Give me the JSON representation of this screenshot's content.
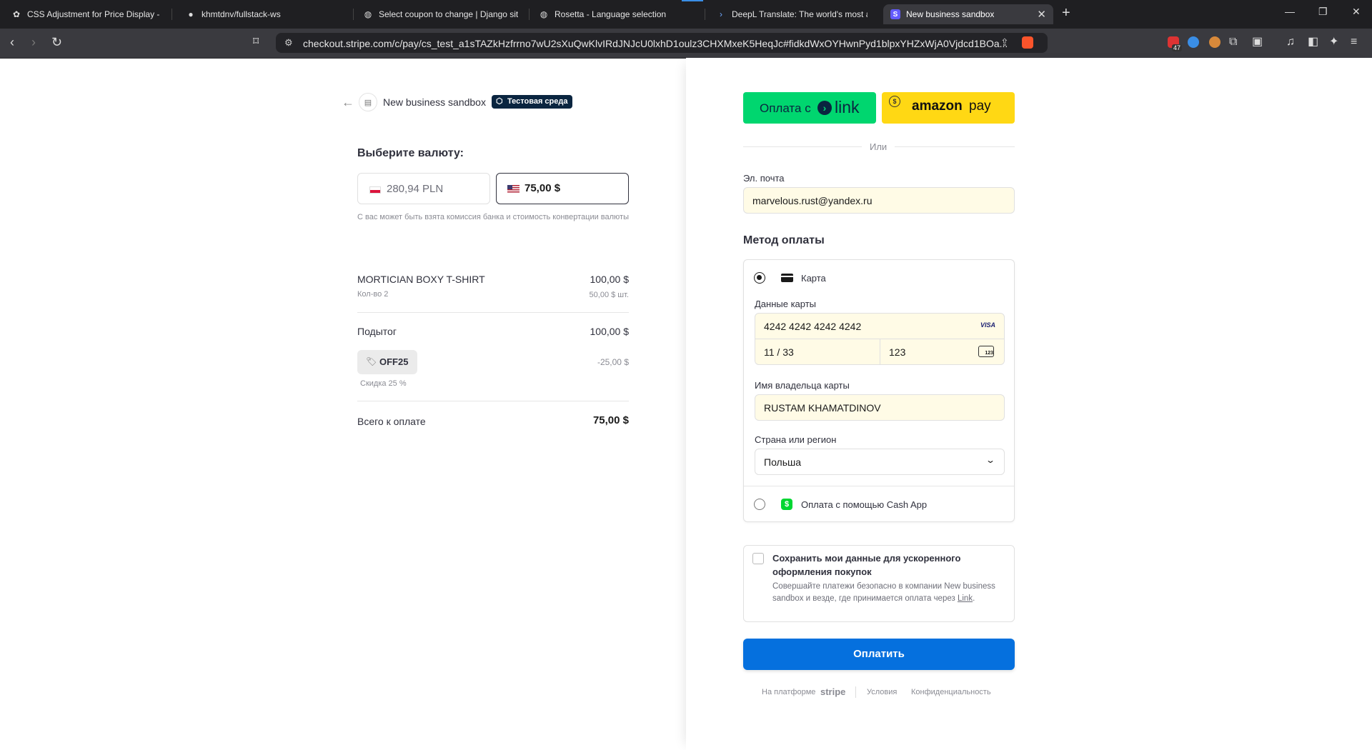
{
  "browser": {
    "tabs": [
      {
        "title": "CSS Adjustment for Price Display - Gr",
        "icon": "openai-icon"
      },
      {
        "title": "khmtdnv/fullstack-ws",
        "icon": "github-icon"
      },
      {
        "title": "Select coupon to change | Django sit",
        "icon": "globe-icon"
      },
      {
        "title": "Rosetta - Language selection",
        "icon": "globe-icon"
      },
      {
        "title": "DeepL Translate: The world's most ac",
        "icon": "deepl-icon"
      },
      {
        "title": "New business sandbox",
        "icon": "stripe-icon"
      }
    ],
    "url": "checkout.stripe.com/c/pay/cs_test_a1sTAZkHzfrrno7wU2sXuQwKlvIRdJNJcU0lxhD1oulz3CHXMxeK5HeqJc#fidkdWxOYHwnPyd1blpxYHZxWjA0Vjdcd1BOa...",
    "badge_count": "47"
  },
  "merchant": {
    "name": "New business sandbox",
    "test_badge": "Тестовая среда"
  },
  "currency": {
    "heading": "Выберите валюту:",
    "options": [
      "280,94 PLN",
      "75,00 $"
    ],
    "note": "С вас может быть взята комиссия банка и стоимость конвертации валюты"
  },
  "order": {
    "item_name": "MORTICIAN BOXY T-SHIRT",
    "item_qty": "Кол-во 2",
    "item_total": "100,00 $",
    "item_unit": "50,00 $ шт.",
    "subtotal_label": "Подытог",
    "subtotal": "100,00 $",
    "coupon_code": "OFF25",
    "coupon_amount": "-25,00 $",
    "coupon_desc": "Скидка 25 %",
    "total_label": "Всего к оплате",
    "total": "75,00 $"
  },
  "pay": {
    "link_prefix": "Оплата с",
    "link_word": "link",
    "amazon_word": "amazon",
    "amazon_pay": "pay",
    "or": "Или",
    "email_label": "Эл. почта",
    "email": "marvelous.rust@yandex.ru",
    "method_heading": "Метод оплаты",
    "card_label": "Карта",
    "card_data_label": "Данные карты",
    "card_number": "4242 4242 4242 4242",
    "card_brand": "VISA",
    "expiry": "11 / 33",
    "cvc": "123",
    "cvc_icon_text": "123",
    "holder_label": "Имя владельца карты",
    "holder": "RUSTAM KHAMATDINOV",
    "country_label": "Страна или регион",
    "country": "Польша",
    "cashapp_label": "Оплата с помощью Cash App",
    "save_title": "Сохранить мои данные для ускоренного оформления покупок",
    "save_desc": "Совершайте платежи безопасно в компании New business sandbox и везде, где принимается оплата через",
    "save_link": "Link",
    "pay_button": "Оплатить",
    "footer_powered": "На платформе",
    "footer_stripe": "stripe",
    "footer_terms": "Условия",
    "footer_privacy": "Конфиденциальность"
  },
  "colors": {
    "link_green": "#00d66f",
    "amazon_yellow": "#ffd814",
    "pay_blue": "#0570de",
    "badge_navy": "#0a2540"
  }
}
